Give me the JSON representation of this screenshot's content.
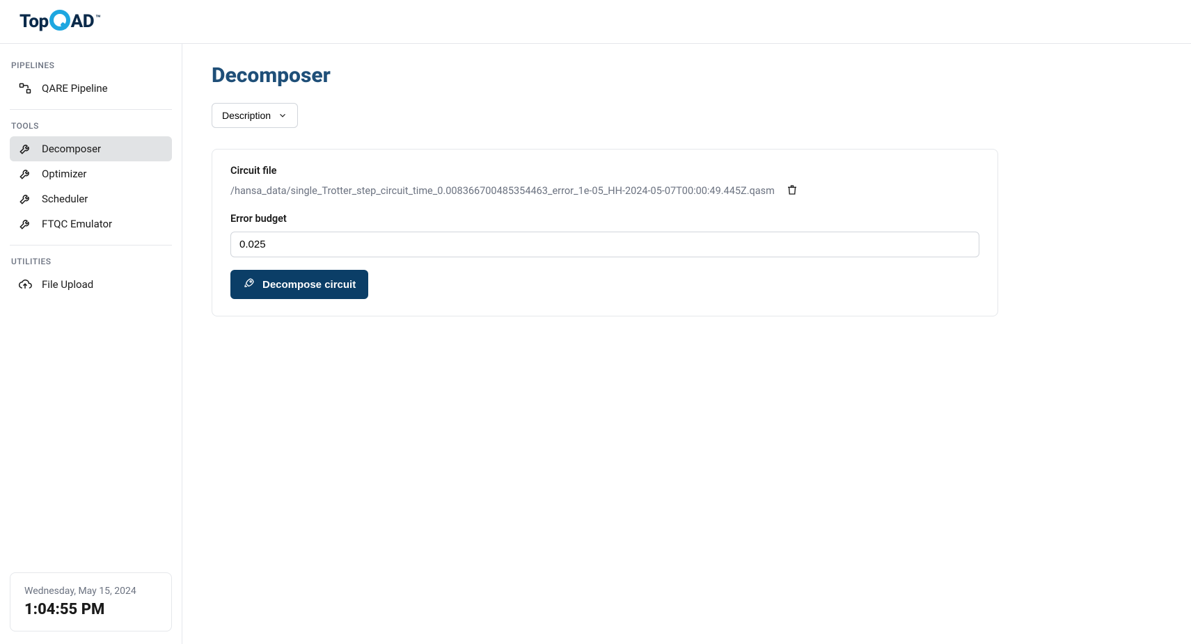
{
  "brand": {
    "prefix": "Top",
    "suffix": "AD",
    "tm": "™"
  },
  "sidebar": {
    "sections": {
      "pipelines_label": "PIPELINES",
      "tools_label": "TOOLS",
      "utilities_label": "UTILITIES"
    },
    "pipelines": [
      {
        "label": "QARE Pipeline"
      }
    ],
    "tools": [
      {
        "label": "Decomposer",
        "active": true
      },
      {
        "label": "Optimizer"
      },
      {
        "label": "Scheduler"
      },
      {
        "label": "FTQC Emulator"
      }
    ],
    "utilities": [
      {
        "label": "File Upload"
      }
    ],
    "clock": {
      "date": "Wednesday, May 15, 2024",
      "time": "1:04:55 PM"
    }
  },
  "main": {
    "title": "Decomposer",
    "description_toggle_label": "Description",
    "panel": {
      "circuit_file_label": "Circuit file",
      "circuit_file_path": "/hansa_data/single_Trotter_step_circuit_time_0.008366700485354463_error_1e-05_HH-2024-05-07T00:00:49.445Z.qasm",
      "error_budget_label": "Error budget",
      "error_budget_value": "0.025",
      "decompose_button_label": "Decompose circuit"
    }
  }
}
